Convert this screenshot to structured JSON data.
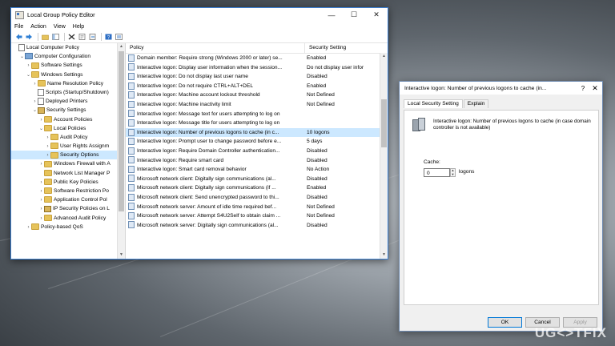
{
  "window": {
    "title": "Local Group Policy Editor",
    "min": "—",
    "max": "☐",
    "close": "✕"
  },
  "menu": [
    "File",
    "Action",
    "View",
    "Help"
  ],
  "tree": [
    {
      "label": "Local Computer Policy",
      "icon": "doc",
      "indent": 0,
      "exp": ""
    },
    {
      "label": "Computer Configuration",
      "icon": "pc",
      "indent": 1,
      "exp": "⌄"
    },
    {
      "label": "Software Settings",
      "icon": "fold",
      "indent": 2,
      "exp": "›"
    },
    {
      "label": "Windows Settings",
      "icon": "fold",
      "indent": 2,
      "exp": "⌄"
    },
    {
      "label": "Name Resolution Policy",
      "icon": "fold",
      "indent": 3,
      "exp": "›"
    },
    {
      "label": "Scripts (Startup/Shutdown)",
      "icon": "doc",
      "indent": 3,
      "exp": ""
    },
    {
      "label": "Deployed Printers",
      "icon": "doc",
      "indent": 3,
      "exp": "›"
    },
    {
      "label": "Security Settings",
      "icon": "lock",
      "indent": 3,
      "exp": "⌄"
    },
    {
      "label": "Account Policies",
      "icon": "fold",
      "indent": 4,
      "exp": "›"
    },
    {
      "label": "Local Policies",
      "icon": "fold",
      "indent": 4,
      "exp": "⌄"
    },
    {
      "label": "Audit Policy",
      "icon": "fold",
      "indent": 5,
      "exp": "›"
    },
    {
      "label": "User Rights Assignm",
      "icon": "fold",
      "indent": 5,
      "exp": "›"
    },
    {
      "label": "Security Options",
      "icon": "fold",
      "indent": 5,
      "exp": "›",
      "selected": true
    },
    {
      "label": "Windows Firewall with A",
      "icon": "fold",
      "indent": 4,
      "exp": "›"
    },
    {
      "label": "Network List Manager P",
      "icon": "fold",
      "indent": 4,
      "exp": ""
    },
    {
      "label": "Public Key Policies",
      "icon": "fold",
      "indent": 4,
      "exp": "›"
    },
    {
      "label": "Software Restriction Po",
      "icon": "fold",
      "indent": 4,
      "exp": "›"
    },
    {
      "label": "Application Control Pol",
      "icon": "fold",
      "indent": 4,
      "exp": "›"
    },
    {
      "label": "IP Security Policies on L",
      "icon": "lock",
      "indent": 4,
      "exp": "›"
    },
    {
      "label": "Advanced Audit Policy",
      "icon": "fold",
      "indent": 4,
      "exp": "›"
    },
    {
      "label": "Policy-based QoS",
      "icon": "fold",
      "indent": 2,
      "exp": "›"
    }
  ],
  "list": {
    "col_policy": "Policy",
    "col_setting": "Security Setting",
    "rows": [
      {
        "policy": "Domain member: Require strong (Windows 2000 or later) se...",
        "setting": "Enabled"
      },
      {
        "policy": "Interactive logon: Display user information when the session...",
        "setting": "Do not display user infor"
      },
      {
        "policy": "Interactive logon: Do not display last user name",
        "setting": "Disabled"
      },
      {
        "policy": "Interactive logon: Do not require CTRL+ALT+DEL",
        "setting": "Enabled"
      },
      {
        "policy": "Interactive logon: Machine account lockout threshold",
        "setting": "Not Defined"
      },
      {
        "policy": "Interactive logon: Machine inactivity limit",
        "setting": "Not Defined"
      },
      {
        "policy": "Interactive logon: Message text for users attempting to log on",
        "setting": ""
      },
      {
        "policy": "Interactive logon: Message title for users attempting to log on",
        "setting": ""
      },
      {
        "policy": "Interactive logon: Number of previous logons to cache (in c...",
        "setting": "10 logons",
        "selected": true
      },
      {
        "policy": "Interactive logon: Prompt user to change password before e...",
        "setting": "5 days"
      },
      {
        "policy": "Interactive logon: Require Domain Controller authentication...",
        "setting": "Disabled"
      },
      {
        "policy": "Interactive logon: Require smart card",
        "setting": "Disabled"
      },
      {
        "policy": "Interactive logon: Smart card removal behavior",
        "setting": "No Action"
      },
      {
        "policy": "Microsoft network client: Digitally sign communications (al...",
        "setting": "Disabled"
      },
      {
        "policy": "Microsoft network client: Digitally sign communications (if ...",
        "setting": "Enabled"
      },
      {
        "policy": "Microsoft network client: Send unencrypted password to thi...",
        "setting": "Disabled"
      },
      {
        "policy": "Microsoft network server: Amount of idle time required bef...",
        "setting": "Not Defined"
      },
      {
        "policy": "Microsoft network server: Attempt S4U2Self to obtain claim ...",
        "setting": "Not Defined"
      },
      {
        "policy": "Microsoft network server: Digitally sign communications (al...",
        "setting": "Disabled"
      }
    ]
  },
  "dialog": {
    "title": "Interactive logon: Number of previous logons to cache (in...",
    "help": "?",
    "close": "✕",
    "tabs": [
      "Local Security Setting",
      "Explain"
    ],
    "description": "Interactive logon: Number of previous logons to cache (in case domain controller is not available)",
    "cache_label": "Cache:",
    "cache_value": "0",
    "cache_unit": "logons",
    "ok": "OK",
    "cancel": "Cancel",
    "apply": "Apply"
  },
  "watermark": "UG<>TFIX"
}
